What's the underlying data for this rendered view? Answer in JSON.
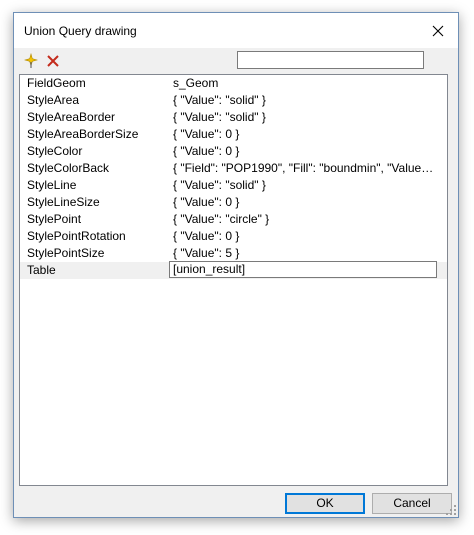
{
  "window": {
    "title": "Union Query drawing"
  },
  "toolbar": {
    "search_value": ""
  },
  "properties": [
    {
      "name": "FieldGeom",
      "value": "s_Geom"
    },
    {
      "name": "StyleArea",
      "value": "{ \"Value\": \"solid\" }"
    },
    {
      "name": "StyleAreaBorder",
      "value": "{ \"Value\": \"solid\" }"
    },
    {
      "name": "StyleAreaBorderSize",
      "value": "{ \"Value\": 0 }"
    },
    {
      "name": "StyleColor",
      "value": "{ \"Value\": 0 }"
    },
    {
      "name": "StyleColorBack",
      "value": "{ \"Field\": \"POP1990\", \"Fill\": \"boundmin\", \"Value\": 42..."
    },
    {
      "name": "StyleLine",
      "value": "{ \"Value\": \"solid\" }"
    },
    {
      "name": "StyleLineSize",
      "value": "{ \"Value\": 0 }"
    },
    {
      "name": "StylePoint",
      "value": "{ \"Value\": \"circle\" }"
    },
    {
      "name": "StylePointRotation",
      "value": "{ \"Value\": 0 }"
    },
    {
      "name": "StylePointSize",
      "value": "{ \"Value\": 5 }"
    },
    {
      "name": "Table",
      "value": "[union_result]"
    }
  ],
  "buttons": {
    "ok": "OK",
    "cancel": "Cancel"
  },
  "colors": {
    "accent": "#0078d7",
    "add_icon": "#f5c400",
    "delete_icon": "#c42b1c"
  },
  "icons": {
    "add": "sparkle-add-icon",
    "delete": "x-delete-icon",
    "close": "close-icon"
  }
}
